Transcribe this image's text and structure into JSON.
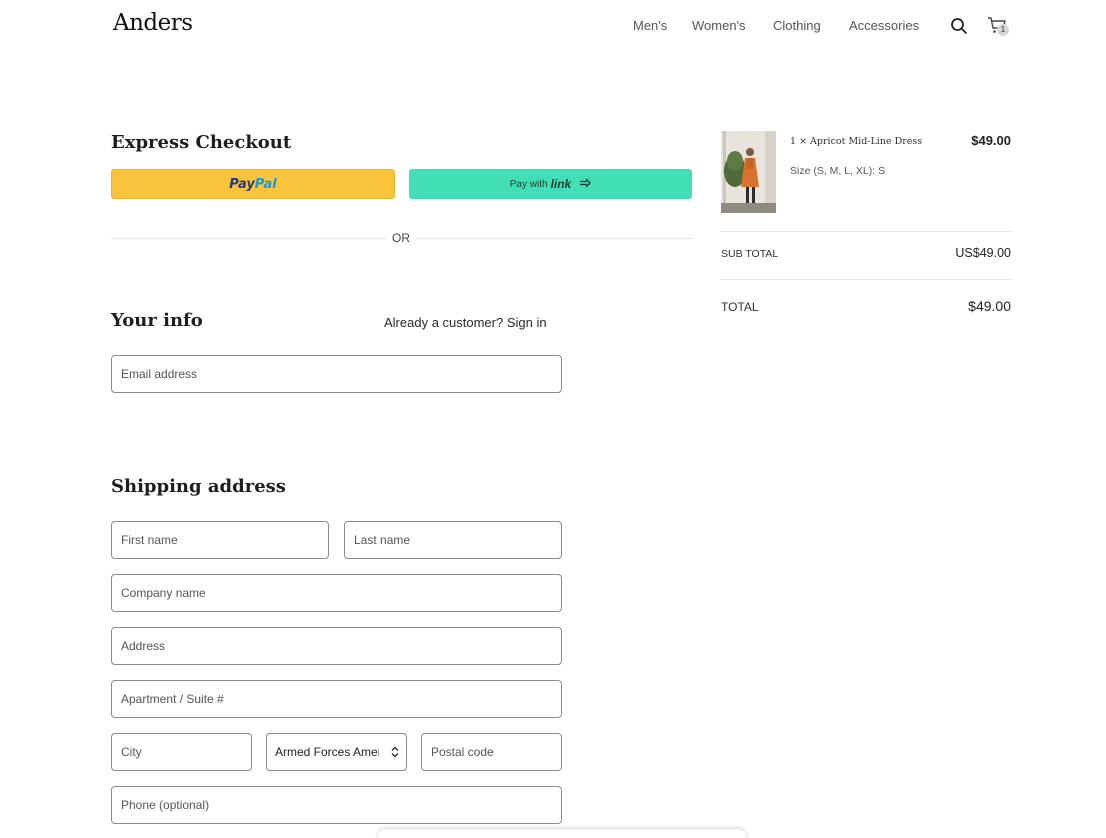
{
  "header": {
    "logo": "Anders",
    "nav": {
      "mens": "Men's",
      "womens": "Women's",
      "clothing": "Clothing",
      "accessories": "Accessories"
    },
    "cart_count": "1",
    "icons": {
      "search": "search-icon",
      "cart": "cart-icon"
    }
  },
  "express": {
    "title": "Express Checkout",
    "paypal_label": "PayPal",
    "paypal_pay": "Pay",
    "paypal_pal": "Pal",
    "link_prefix": "Pay with",
    "link_brand": "link",
    "or_label": "OR",
    "colors": {
      "paypal": "#f9c33c",
      "link": "#42dfb6"
    }
  },
  "your_info": {
    "title": "Your info",
    "signin_text": "Already a customer? Sign in",
    "email_placeholder": "Email address"
  },
  "shipping": {
    "title": "Shipping address",
    "first_name_placeholder": "First name",
    "last_name_placeholder": "Last name",
    "company_placeholder": "Company name",
    "address_placeholder": "Address",
    "apartment_placeholder": "Apartment / Suite #",
    "city_placeholder": "City",
    "state_value": "Armed Forces Americas",
    "postal_placeholder": "Postal code",
    "phone_placeholder": "Phone (optional)"
  },
  "order": {
    "item_name": "1 × Apricot Mid-Line Dress",
    "item_size": "Size (S, M, L, XL): S",
    "item_price": "$49.00",
    "subtotal_label": "SUB TOTAL",
    "subtotal_value": "US$49.00",
    "total_label": "TOTAL",
    "total_value": "$49.00"
  }
}
